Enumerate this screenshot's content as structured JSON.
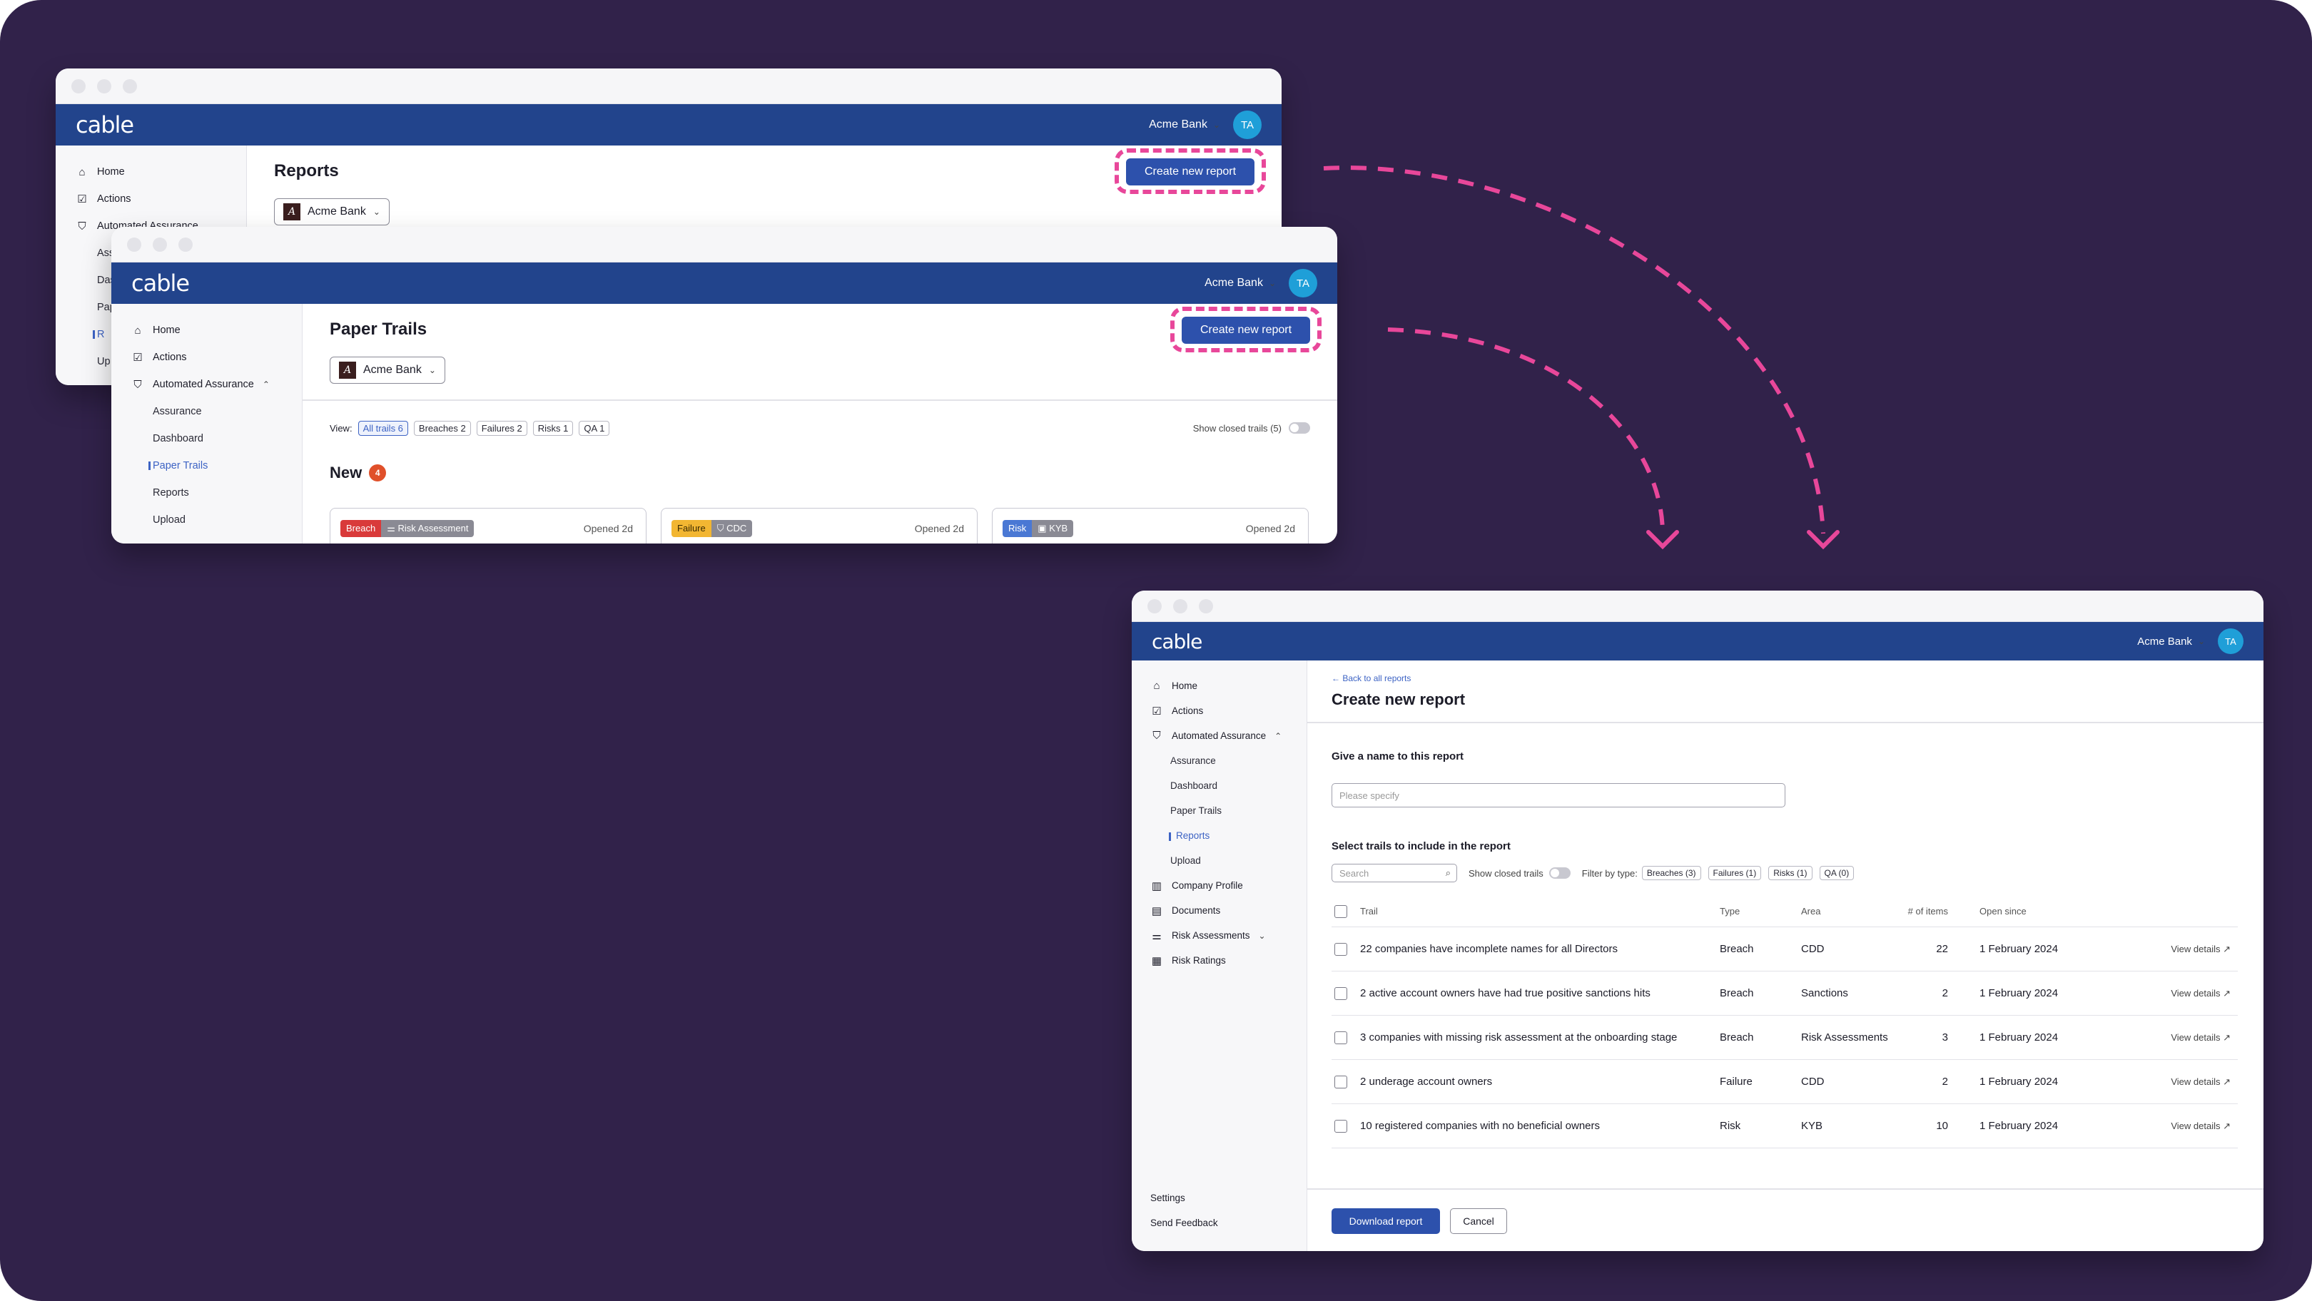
{
  "colors": {
    "background": "#31224a",
    "appbar": "#22448c",
    "primary": "#2d51ac",
    "highlight": "#e8479a",
    "avatar": "#1f9fd8"
  },
  "app": {
    "logo": "cable",
    "org": "Acme Bank",
    "avatar": "TA"
  },
  "reports_window": {
    "title": "Reports",
    "create_button": "Create new report",
    "bank_selector": "Acme Bank",
    "bank_logo": "A",
    "nav": [
      "Home",
      "Actions",
      "Automated Assurance",
      "Ass",
      "Das",
      "Pap",
      "R",
      "Up"
    ]
  },
  "trails_window": {
    "title": "Paper Trails",
    "create_button": "Create new report",
    "bank_selector": "Acme Bank",
    "bank_logo": "A",
    "nav": {
      "home": "Home",
      "actions": "Actions",
      "aa": "Automated Assurance",
      "assurance": "Assurance",
      "dashboard": "Dashboard",
      "paper_trails": "Paper Trails",
      "reports": "Reports",
      "upload": "Upload"
    },
    "view_label": "View:",
    "filters": [
      "All trails 6",
      "Breaches 2",
      "Failures 2",
      "Risks 1",
      "QA 1"
    ],
    "show_closed": "Show closed trails (5)",
    "section": "New",
    "section_count": "4",
    "cards": [
      {
        "tag": "Breach",
        "tag_color": "#d93a3a",
        "area": "Risk Assessment",
        "area_icon": "sliders-icon",
        "opened": "Opened 2d"
      },
      {
        "tag": "Failure",
        "tag_color": "#f2b632",
        "area": "CDC",
        "area_icon": "shield-icon",
        "opened": "Opened 2d"
      },
      {
        "tag": "Risk",
        "tag_color": "#4a78d4",
        "area": "KYB",
        "area_icon": "briefcase-icon",
        "opened": "Opened 2d"
      }
    ]
  },
  "create_window": {
    "back_link": "← Back to all reports",
    "title": "Create new report",
    "name_label": "Give a name to this report",
    "name_placeholder": "Please specify",
    "select_label": "Select trails to include in the report",
    "search_placeholder": "Search",
    "show_closed": "Show closed trails",
    "filter_label": "Filter by type:",
    "filters": [
      "Breaches (3)",
      "Failures (1)",
      "Risks (1)",
      "QA (0)"
    ],
    "columns": {
      "trail": "Trail",
      "type": "Type",
      "area": "Area",
      "items": "# of items",
      "since": "Open since"
    },
    "rows": [
      {
        "trail": "22 companies have incomplete names for all Directors",
        "type": "Breach",
        "area": "CDD",
        "items": "22",
        "since": "1 February 2024",
        "link": "View details ↗"
      },
      {
        "trail": "2 active account owners have had true positive sanctions hits",
        "type": "Breach",
        "area": "Sanctions",
        "items": "2",
        "since": "1 February 2024",
        "link": "View details ↗"
      },
      {
        "trail": "3 companies with missing risk assessment at the onboarding stage",
        "type": "Breach",
        "area": "Risk Assessments",
        "items": "3",
        "since": "1 February 2024",
        "link": "View details ↗"
      },
      {
        "trail": "2 underage account owners",
        "type": "Failure",
        "area": "CDD",
        "items": "2",
        "since": "1 February 2024",
        "link": "View details ↗"
      },
      {
        "trail": "10 registered companies with no beneficial owners",
        "type": "Risk",
        "area": "KYB",
        "items": "10",
        "since": "1 February 2024",
        "link": "View details ↗"
      }
    ],
    "download_button": "Download report",
    "cancel_button": "Cancel",
    "nav": {
      "home": "Home",
      "actions": "Actions",
      "aa": "Automated Assurance",
      "assurance": "Assurance",
      "dashboard": "Dashboard",
      "paper_trails": "Paper Trails",
      "reports": "Reports",
      "upload": "Upload",
      "company_profile": "Company Profile",
      "documents": "Documents",
      "risk_assessments": "Risk Assessments",
      "risk_ratings": "Risk Ratings",
      "settings": "Settings",
      "feedback": "Send Feedback"
    }
  }
}
